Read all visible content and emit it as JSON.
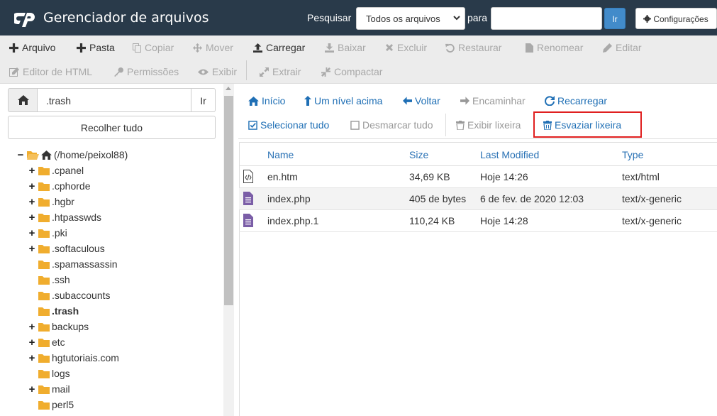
{
  "header": {
    "app_title": "Gerenciador de arquivos",
    "search_label": "Pesquisar",
    "search_scope": "Todos os arquivos",
    "para_label": "para",
    "search_value": "",
    "go_label": "Ir",
    "settings_label": "Configurações",
    "bg_color": "#293a4a"
  },
  "toolbar": {
    "row1": [
      {
        "label": "Arquivo",
        "icon": "plus-icon",
        "enabled": true
      },
      {
        "label": "Pasta",
        "icon": "plus-icon",
        "enabled": true
      },
      {
        "label": "Copiar",
        "icon": "copy-icon",
        "enabled": false
      },
      {
        "label": "Mover",
        "icon": "move-icon",
        "enabled": false
      },
      {
        "label": "Carregar",
        "icon": "upload-icon",
        "enabled": true
      },
      {
        "label": "Baixar",
        "icon": "download-icon",
        "enabled": false
      },
      {
        "label": "Excluir",
        "icon": "delete-icon",
        "enabled": false
      },
      {
        "label": "Restaurar",
        "icon": "restore-icon",
        "enabled": false
      },
      {
        "label": "Renomear",
        "icon": "file-icon",
        "enabled": false
      },
      {
        "label": "Editar",
        "icon": "pencil-icon",
        "enabled": false
      }
    ],
    "row2": [
      {
        "label": "Editor de HTML",
        "icon": "edit-icon",
        "enabled": false
      },
      {
        "label": "Permissões",
        "icon": "key-icon",
        "enabled": false
      },
      {
        "label": "Exibir",
        "icon": "eye-icon",
        "enabled": false
      },
      {
        "label": "Extrair",
        "icon": "expand-icon",
        "enabled": false
      },
      {
        "label": "Compactar",
        "icon": "compress-icon",
        "enabled": false
      }
    ]
  },
  "left": {
    "path_value": ".trash",
    "path_go": "Ir",
    "collapse_all": "Recolher tudo",
    "tree": [
      {
        "label": "(/home/peixol88)",
        "expander": "−",
        "level": 0,
        "home": true
      },
      {
        "label": ".cpanel",
        "expander": "+",
        "level": 1
      },
      {
        "label": ".cphorde",
        "expander": "+",
        "level": 1
      },
      {
        "label": ".hgbr",
        "expander": "+",
        "level": 1
      },
      {
        "label": ".htpasswds",
        "expander": "+",
        "level": 1
      },
      {
        "label": ".pki",
        "expander": "+",
        "level": 1
      },
      {
        "label": ".softaculous",
        "expander": "+",
        "level": 1
      },
      {
        "label": ".spamassassin",
        "expander": "",
        "level": 1
      },
      {
        "label": ".ssh",
        "expander": "",
        "level": 1
      },
      {
        "label": ".subaccounts",
        "expander": "",
        "level": 1
      },
      {
        "label": ".trash",
        "expander": "",
        "level": 1,
        "current": true
      },
      {
        "label": "backups",
        "expander": "+",
        "level": 1
      },
      {
        "label": "etc",
        "expander": "+",
        "level": 1
      },
      {
        "label": "hgtutoriais.com",
        "expander": "+",
        "level": 1
      },
      {
        "label": "logs",
        "expander": "",
        "level": 1
      },
      {
        "label": "mail",
        "expander": "+",
        "level": 1
      },
      {
        "label": "perl5",
        "expander": "",
        "level": 1
      }
    ]
  },
  "nav": {
    "home": "Início",
    "up": "Um nível acima",
    "back": "Voltar",
    "forward": "Encaminhar",
    "reload": "Recarregar",
    "select_all": "Selecionar tudo",
    "deselect_all": "Desmarcar tudo",
    "view_trash": "Exibir lixeira",
    "empty_trash": "Esvaziar lixeira"
  },
  "table": {
    "columns": [
      "Name",
      "Size",
      "Last Modified",
      "Type"
    ],
    "rows": [
      {
        "name": "en.htm",
        "size": "34,69 KB",
        "modified": "Hoje 14:26",
        "type": "text/html",
        "icon": "html-file-icon"
      },
      {
        "name": "index.php",
        "size": "405 de bytes",
        "modified": "6 de fev. de 2020 12:03",
        "type": "text/x-generic",
        "icon": "text-file-icon"
      },
      {
        "name": "index.php.1",
        "size": "110,24 KB",
        "modified": "Hoje 14:28",
        "type": "text/x-generic",
        "icon": "text-file-icon"
      }
    ]
  },
  "colors": {
    "link": "#1f6fb5",
    "folder": "#f0ad2e",
    "highlight_box": "#e02020",
    "php_icon": "#7b5ea7"
  }
}
